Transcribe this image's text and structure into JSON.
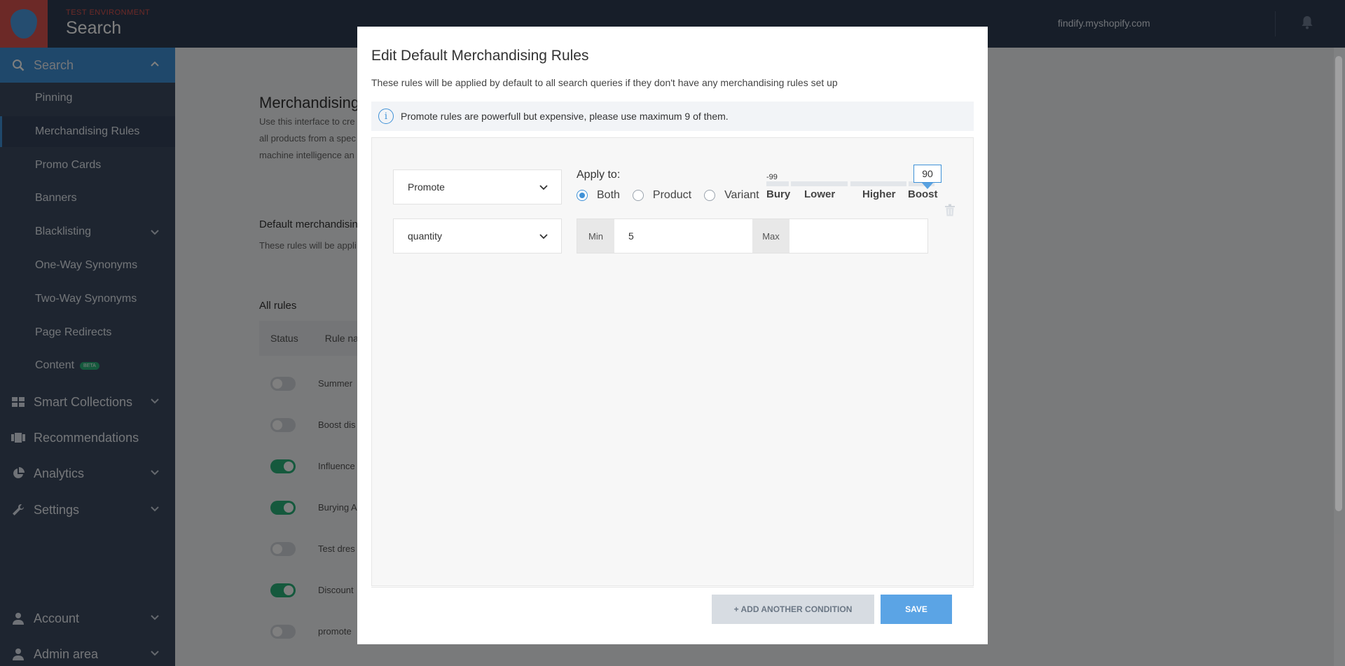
{
  "topbar": {
    "env_label": "TEST ENVIRONMENT",
    "app_title": "Search",
    "shop_domain": "findify.myshopify.com"
  },
  "sidebar": {
    "sections": {
      "search": "Search",
      "smart_collections": "Smart Collections",
      "recommendations": "Recommendations",
      "analytics": "Analytics",
      "settings": "Settings",
      "account": "Account",
      "admin_area": "Admin area"
    },
    "items": [
      {
        "label": "Pinning"
      },
      {
        "label": "Merchandising Rules"
      },
      {
        "label": "Promo Cards"
      },
      {
        "label": "Banners"
      },
      {
        "label": "Blacklisting"
      },
      {
        "label": "One-Way Synonyms"
      },
      {
        "label": "Two-Way Synonyms"
      },
      {
        "label": "Page Redirects"
      },
      {
        "label": "Content"
      }
    ],
    "beta_badge": "BETA"
  },
  "background": {
    "title": "Merchandising R",
    "desc_lines": [
      "Use this interface to cre",
      "all products from a spec",
      "machine intelligence an"
    ],
    "default_title": "Default merchandisin",
    "default_desc": "These rules will be appli",
    "all_rules": "All rules",
    "table_headers": {
      "status": "Status",
      "rule_name": "Rule nam"
    },
    "rows": [
      {
        "name": "Summer",
        "on": false
      },
      {
        "name": "Boost dis",
        "on": false
      },
      {
        "name": "Influence",
        "on": true
      },
      {
        "name": "Burying A",
        "on": true
      },
      {
        "name": "Test dres",
        "on": false
      },
      {
        "name": "Discount",
        "on": true
      },
      {
        "name": "promote",
        "on": false
      }
    ]
  },
  "modal": {
    "title": "Edit Default Merchandising Rules",
    "subtitle": "These rules will be applied by default to all search queries if they don't have any merchandising rules set up",
    "info_text": "Promote rules are powerfull but expensive, please use maximum 9 of them.",
    "action_select": "Promote",
    "field_select": "quantity",
    "apply_to_label": "Apply to:",
    "apply_options": [
      "Both",
      "Product",
      "Variant"
    ],
    "apply_selected": "Both",
    "slider": {
      "min_label": "-99",
      "value": "90",
      "ticks": [
        "Bury",
        "Lower",
        "Higher",
        "Boost"
      ]
    },
    "min_label": "Min",
    "min_value": "5",
    "max_label": "Max",
    "max_value": "",
    "add_condition_label": "+ ADD ANOTHER CONDITION",
    "save_label": "SAVE"
  },
  "colors": {
    "accent": "#3f91d7",
    "sidebar_bg": "#3c4a60",
    "topbar_bg": "#2f3d52",
    "toggle_on": "#2ab27b"
  }
}
